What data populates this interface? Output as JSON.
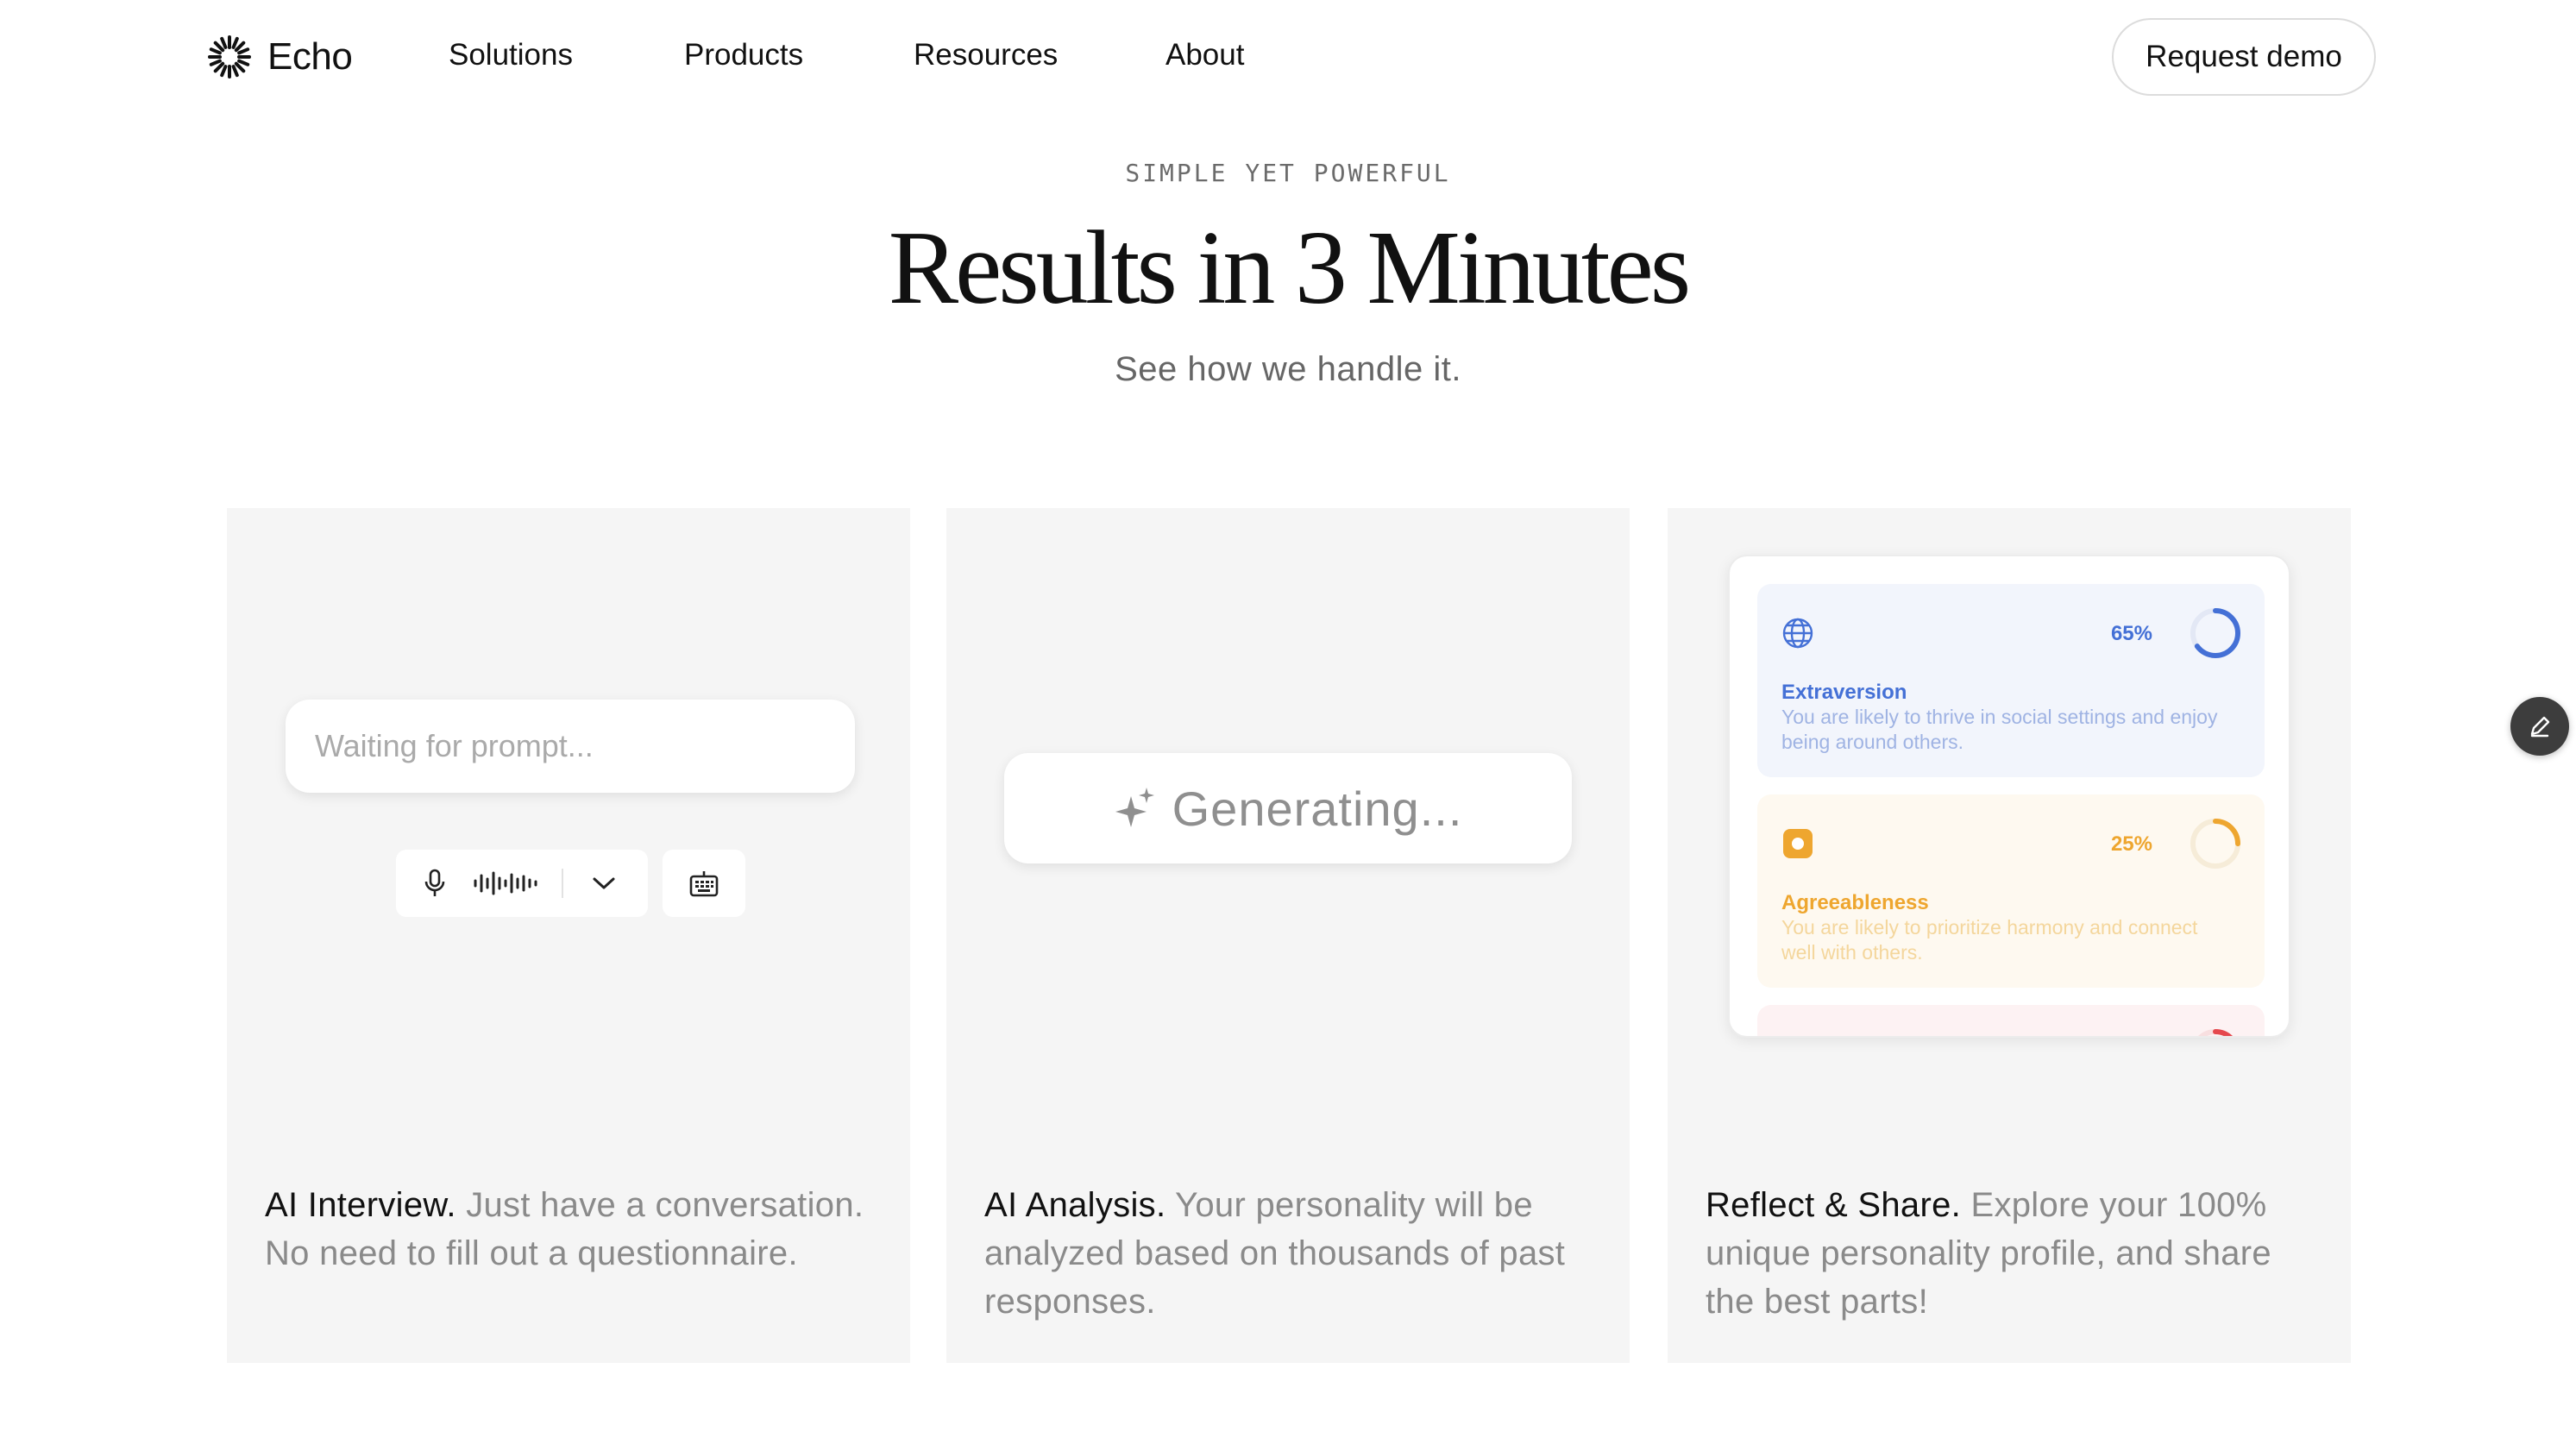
{
  "nav": {
    "logo_text": "Echo",
    "links": [
      "Solutions",
      "Products",
      "Resources",
      "About"
    ],
    "cta": "Request demo"
  },
  "hero": {
    "eyebrow": "SIMPLE YET POWERFUL",
    "title": "Results in 3 Minutes",
    "subtitle": "See how we handle it."
  },
  "cards": [
    {
      "prompt_placeholder": "Waiting for prompt...",
      "controls": {
        "mic_icon": "microphone-icon",
        "wave_icon": "waveform-icon",
        "dropdown_icon": "chevron-down-icon",
        "keyboard_icon": "keyboard-icon"
      },
      "lead": "AI Interview.",
      "text": " Just have a conversation. No need to fill out a questionnaire."
    },
    {
      "status": "Generating...",
      "status_icon": "sparkle-icon",
      "lead": "AI Analysis.",
      "text": " Your personality will be analyzed based on thousands of past responses."
    },
    {
      "traits": [
        {
          "name": "Extraversion",
          "percent": "65%",
          "fraction": 0.65,
          "description": "You are likely to thrive in social settings and enjoy being around others.",
          "color": "#4470d6",
          "icon": "globe-icon"
        },
        {
          "name": "Agreeableness",
          "percent": "25%",
          "fraction": 0.25,
          "description": "You are likely to prioritize harmony and connect well with others.",
          "color": "#eea62f",
          "icon": "circle-square-icon"
        },
        {
          "color": "#e5484d",
          "fraction": 0.25
        }
      ],
      "lead": "Reflect & Share.",
      "text": " Explore your 100% unique personality profile, and share the best parts!"
    }
  ],
  "fab_icon": "pencil-icon"
}
